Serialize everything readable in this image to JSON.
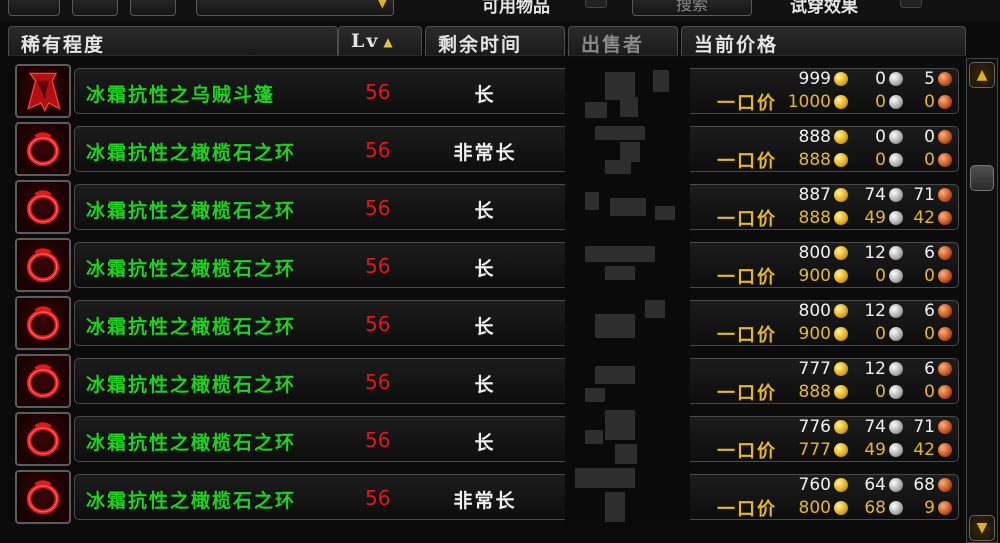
{
  "top": {
    "partial_text_1": "可用物品",
    "search_label": "搜索",
    "partial_text_2": "试穿效果"
  },
  "headers": {
    "rarity": "稀有程度",
    "level": "Lv",
    "time_left": "剩余时间",
    "seller": "出售者",
    "current_price": "当前价格"
  },
  "buyout_label": "一口价",
  "colors": {
    "item_name": "#1fd21f",
    "level": "#e01818",
    "buyout": "#e8b820"
  },
  "items": [
    {
      "icon": "cloak-icon",
      "name": "冰霜抗性之乌贼斗篷",
      "level": "56",
      "time": "长",
      "bid": [
        "999",
        "0",
        "5"
      ],
      "buyout": [
        "1000",
        "0",
        "0"
      ]
    },
    {
      "icon": "ring-icon",
      "name": "冰霜抗性之橄榄石之环",
      "level": "56",
      "time": "非常长",
      "bid": [
        "888",
        "0",
        "0"
      ],
      "buyout": [
        "888",
        "0",
        "0"
      ]
    },
    {
      "icon": "ring-icon",
      "name": "冰霜抗性之橄榄石之环",
      "level": "56",
      "time": "长",
      "bid": [
        "887",
        "74",
        "71"
      ],
      "buyout": [
        "888",
        "49",
        "42"
      ]
    },
    {
      "icon": "ring-icon",
      "name": "冰霜抗性之橄榄石之环",
      "level": "56",
      "time": "长",
      "bid": [
        "800",
        "12",
        "6"
      ],
      "buyout": [
        "900",
        "0",
        "0"
      ]
    },
    {
      "icon": "ring-icon",
      "name": "冰霜抗性之橄榄石之环",
      "level": "56",
      "time": "长",
      "bid": [
        "800",
        "12",
        "6"
      ],
      "buyout": [
        "900",
        "0",
        "0"
      ]
    },
    {
      "icon": "ring-icon",
      "name": "冰霜抗性之橄榄石之环",
      "level": "56",
      "time": "长",
      "bid": [
        "777",
        "12",
        "6"
      ],
      "buyout": [
        "888",
        "0",
        "0"
      ]
    },
    {
      "icon": "ring-icon",
      "name": "冰霜抗性之橄榄石之环",
      "level": "56",
      "time": "长",
      "bid": [
        "776",
        "74",
        "71"
      ],
      "buyout": [
        "777",
        "49",
        "42"
      ]
    },
    {
      "icon": "ring-icon",
      "name": "冰霜抗性之橄榄石之环",
      "level": "56",
      "time": "非常长",
      "bid": [
        "760",
        "64",
        "68"
      ],
      "buyout": [
        "800",
        "68",
        "9"
      ]
    }
  ]
}
